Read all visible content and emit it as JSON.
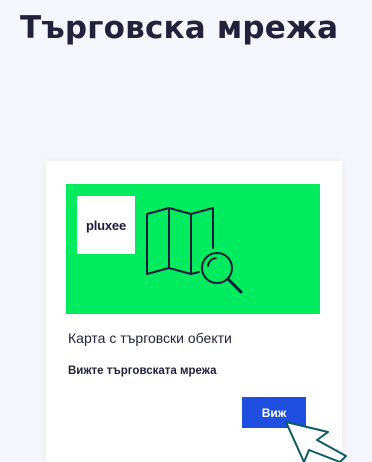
{
  "page": {
    "title": "Търговска мрежа"
  },
  "card": {
    "logo_text": "pluxee",
    "title": "Карта с търговски обекти",
    "link_text": "Вижте търговската мрежа",
    "button_label": "Виж",
    "icon": "map-search-icon"
  },
  "colors": {
    "brand_green": "#00eb5e",
    "button_blue": "#1f4fe0",
    "page_background": "#f4f6fb",
    "text_dark": "#22223b"
  }
}
